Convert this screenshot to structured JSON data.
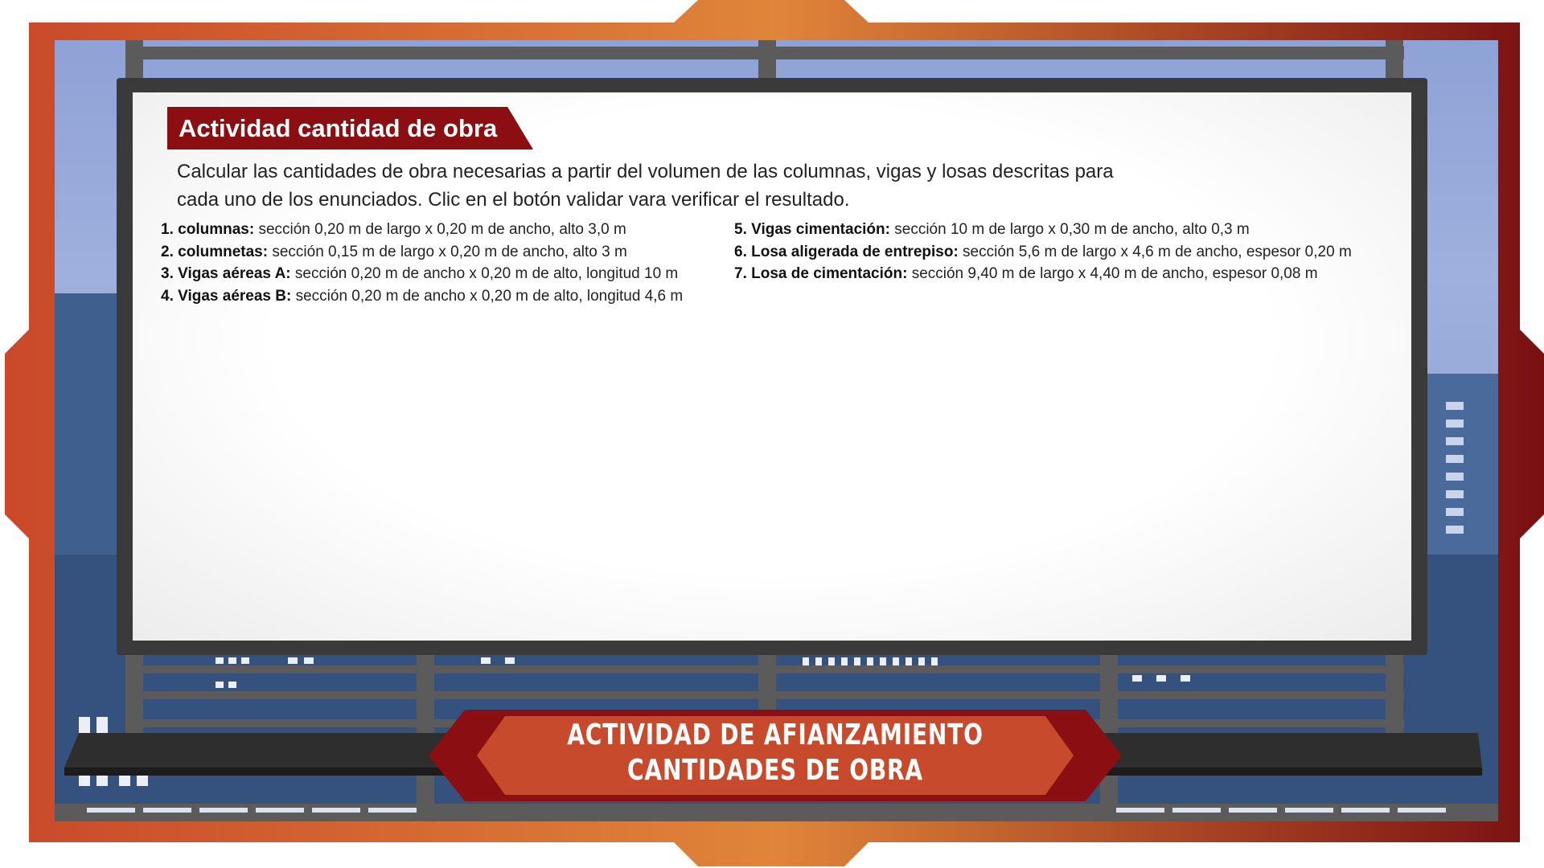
{
  "activity": {
    "title": "Actividad cantidad de obra",
    "intro_line1": "Calcular las cantidades de obra necesarias a partir del volumen de las columnas, vigas y losas descritas para",
    "intro_line2": "cada uno de los enunciados. Clic en el botón validar vara verificar el resultado."
  },
  "items": [
    {
      "num": "1.",
      "term": "columnas:",
      "desc": " sección 0,20 m de largo x 0,20 m de ancho, alto 3,0 m"
    },
    {
      "num": "2.",
      "term": "columnetas:",
      "desc": " sección 0,15 m de largo x 0,20 m de ancho, alto 3 m"
    },
    {
      "num": "3.",
      "term": "Vigas aéreas A:",
      "desc": " sección 0,20 m de ancho x 0,20 m de alto, longitud 10 m"
    },
    {
      "num": "4.",
      "term": "Vigas aéreas B:",
      "desc": " sección 0,20 m de ancho x 0,20 m de alto, longitud 4,6 m"
    },
    {
      "num": "5.",
      "term": "Vigas cimentación:",
      "desc": " sección 10 m de largo x 0,30 m de ancho, alto 0,3 m"
    },
    {
      "num": "6.",
      "term": "Losa aligerada de entrepiso:",
      "desc": " sección 5,6 m de largo x 4,6 m de ancho, espesor 0,20 m"
    },
    {
      "num": "7.",
      "term": "Losa de cimentación:",
      "desc": " sección 9,40 m de largo x 4,40 m de ancho, espesor 0,08 m"
    }
  ],
  "banner": {
    "line1": "ACTIVIDAD DE AFIANZAMIENTO",
    "line2": "CANTIDADES DE OBRA"
  },
  "colors": {
    "frame_start": "#c9492a",
    "frame_mid": "#e0853a",
    "frame_end": "#7a0f12",
    "title_bg": "#8b0e12",
    "banner_dark": "#8b0e12",
    "banner_light": "#c84a2c"
  }
}
